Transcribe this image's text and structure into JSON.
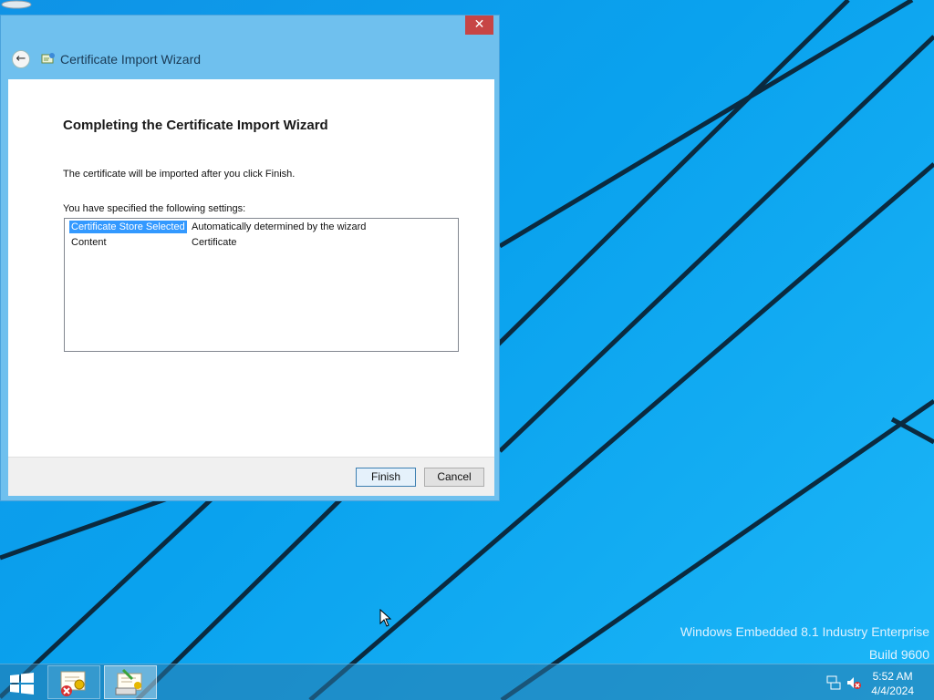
{
  "window": {
    "title": "Certificate Import Wizard",
    "close_glyph": "✕",
    "back_glyph": "←",
    "heading": "Completing the Certificate Import Wizard",
    "info_text": "The certificate will be imported after you click Finish.",
    "settings_label": "You have specified the following settings:",
    "settings": [
      {
        "key": "Certificate Store Selected",
        "value": "Automatically determined by the wizard",
        "selected": true
      },
      {
        "key": "Content",
        "value": "Certificate",
        "selected": false
      }
    ],
    "finish_label": "Finish",
    "cancel_label": "Cancel"
  },
  "desktop": {
    "watermark_line1": "Windows Embedded 8.1 Industry Enterprise",
    "watermark_line2": "Build 9600"
  },
  "taskbar": {
    "items": [
      {
        "icon": "certificate-error-icon"
      },
      {
        "icon": "certificate-import-wizard-icon"
      }
    ],
    "clock_time": "5:52 AM",
    "clock_date": "4/4/2024"
  },
  "colors": {
    "desktop": "#0aa2ee",
    "window_frame": "#6fc0ee",
    "close_button": "#c74545",
    "selection": "#3399ff"
  }
}
